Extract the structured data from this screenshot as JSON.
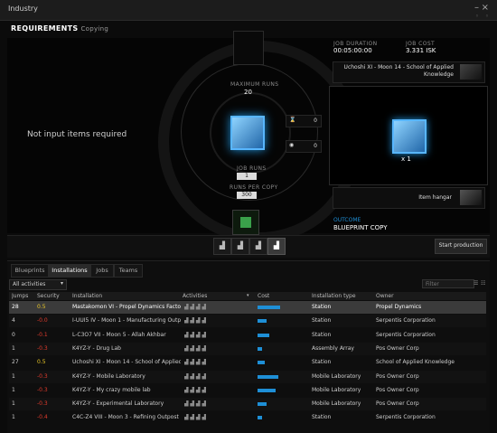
{
  "window": {
    "title": "Industry",
    "close_icon": "close-icon",
    "minimize_icon": "minimize-icon"
  },
  "header": {
    "title": "REQUIREMENTS",
    "subtitle": "Copying"
  },
  "left_panel": {
    "message": "Not input items required"
  },
  "center": {
    "max_runs_label": "MAXIMUM RUNS",
    "max_runs_value": "20",
    "job_runs_label": "JOB RUNS",
    "job_runs_value": "1",
    "runs_per_copy_label": "RUNS PER COPY",
    "runs_per_copy_value": "300",
    "time_eff_value": "0",
    "material_eff_value": "0"
  },
  "job": {
    "duration_label": "JOB DURATION",
    "duration_value": "00:05:00:00",
    "cost_label": "JOB COST",
    "cost_value": "3.331 ISK",
    "facility": "Uchoshi XI - Moon 14 - School of Applied Knowledge",
    "output_qty": "x 1",
    "output_location": "Item hangar",
    "outcome_label": "OUTCOME",
    "outcome_value": "BLUEPRINT COPY"
  },
  "actions": {
    "start_label": "Start production"
  },
  "tabs": [
    {
      "label": "Blueprints",
      "active": false
    },
    {
      "label": "Installations",
      "active": true
    },
    {
      "label": "Jobs",
      "active": false
    },
    {
      "label": "Teams",
      "active": false
    }
  ],
  "filter": {
    "activity": "All activities",
    "placeholder": "Filter"
  },
  "table": {
    "columns": [
      "Jumps",
      "Security",
      "Installation",
      "Activities",
      "Cost",
      "Installation type",
      "Owner"
    ],
    "rows": [
      {
        "jumps": "28",
        "security": "0.5",
        "sec_color": "#e8c628",
        "installation": "Mastakomon VI - Propel Dynamics Factory",
        "cost": 0.5,
        "type": "Station",
        "owner": "Propel Dynamics",
        "selected": true
      },
      {
        "jumps": "4",
        "security": "-0.0",
        "sec_color": "#e03a2c",
        "installation": "I-UUI5 IV - Moon 1 - Manufacturing Outpost",
        "cost": 0.2,
        "type": "Station",
        "owner": "Serpentis Corporation"
      },
      {
        "jumps": "0",
        "security": "-0.1",
        "sec_color": "#e03a2c",
        "installation": "L-C3O7 VII - Moon 5 - Allah Akhbar",
        "cost": 0.25,
        "type": "Station",
        "owner": "Serpentis Corporation"
      },
      {
        "jumps": "1",
        "security": "-0.3",
        "sec_color": "#e03a2c",
        "installation": "K4YZ-Y - Drug Lab",
        "cost": 0.1,
        "type": "Assembly Array",
        "owner": "Pos Owner Corp"
      },
      {
        "jumps": "27",
        "security": "0.5",
        "sec_color": "#e8c628",
        "installation": "Uchoshi XI - Moon 14 - School of Applied",
        "cost": 0.15,
        "type": "Station",
        "owner": "School of Applied Knowledge"
      },
      {
        "jumps": "1",
        "security": "-0.3",
        "sec_color": "#e03a2c",
        "installation": "K4YZ-Y - Mobile Laboratory",
        "cost": 0.45,
        "type": "Mobile Laboratory",
        "owner": "Pos Owner Corp"
      },
      {
        "jumps": "1",
        "security": "-0.3",
        "sec_color": "#e03a2c",
        "installation": "K4YZ-Y - My crazy mobile lab",
        "cost": 0.4,
        "type": "Mobile Laboratory",
        "owner": "Pos Owner Corp"
      },
      {
        "jumps": "1",
        "security": "-0.3",
        "sec_color": "#e03a2c",
        "installation": "K4YZ-Y - Experimental Laboratory",
        "cost": 0.2,
        "type": "Mobile Laboratory",
        "owner": "Pos Owner Corp"
      },
      {
        "jumps": "1",
        "security": "-0.4",
        "sec_color": "#e03a2c",
        "installation": "C4C-Z4 VIII - Moon 3 - Refining Outpost",
        "cost": 0.1,
        "type": "Station",
        "owner": "Serpentis Corporation"
      }
    ]
  },
  "colors": {
    "accent": "#1e8fd6",
    "sec_high": "#e8c628",
    "sec_low": "#e03a2c"
  }
}
